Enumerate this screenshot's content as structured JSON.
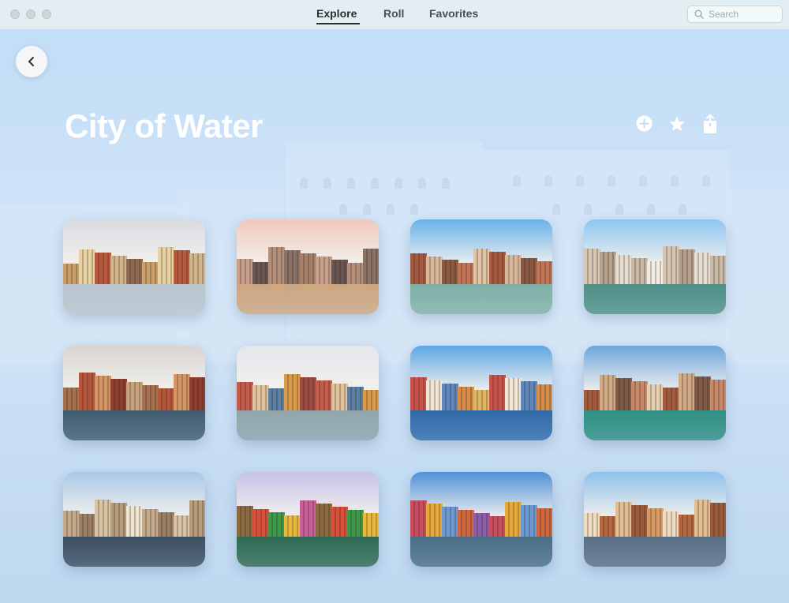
{
  "titlebar": {
    "tabs": [
      {
        "label": "Explore",
        "active": true
      },
      {
        "label": "Roll",
        "active": false
      },
      {
        "label": "Favorites",
        "active": false
      }
    ],
    "search": {
      "placeholder": "Search",
      "icon": "search-icon"
    }
  },
  "page": {
    "title": "City of Water",
    "back_icon": "chevron-left-icon",
    "actions": [
      {
        "name": "add",
        "icon": "plus-circle-icon"
      },
      {
        "name": "favorite",
        "icon": "star-icon"
      },
      {
        "name": "share",
        "icon": "share-icon"
      }
    ]
  },
  "photos": [
    {
      "subject": "stockholm-waterfront",
      "sky": "#d9dbe0",
      "water": "#b9c4cc",
      "city": [
        "#c9a06a",
        "#e8d2a4",
        "#b9593c",
        "#d3b58a",
        "#8d6a4f"
      ]
    },
    {
      "subject": "river-bridge-sunset",
      "sky": "#f1c8bd",
      "water": "#cda67e",
      "city": [
        "#a8806a",
        "#c9a08b",
        "#6a5650",
        "#b48f7a",
        "#8a7266"
      ]
    },
    {
      "subject": "grand-canal-day",
      "sky": "#69b2ea",
      "water": "#7fb0a6",
      "city": [
        "#c27556",
        "#e1c4a3",
        "#a55a3f",
        "#d9b89a",
        "#8a5a42"
      ]
    },
    {
      "subject": "canal-poles-palaces",
      "sky": "#8ec6f0",
      "water": "#4d8f86",
      "city": [
        "#e6ddd0",
        "#c9b9a5",
        "#f2ece3",
        "#d7c6b1",
        "#b5a08a"
      ]
    },
    {
      "subject": "narrow-canal-boats",
      "sky": "#d7d4d1",
      "water": "#3f5d6e",
      "city": [
        "#b5563a",
        "#d59663",
        "#8f3f2d",
        "#c7a37e",
        "#a6714e"
      ]
    },
    {
      "subject": "colorful-canal-cloudy",
      "sky": "#e4e6ea",
      "water": "#8fa5aa",
      "city": [
        "#c55b4b",
        "#e2c29a",
        "#5d7fa3",
        "#d99b4a",
        "#9d4b3e"
      ]
    },
    {
      "subject": "harbor-sailboats",
      "sky": "#5da8e6",
      "water": "#2f6aa8",
      "city": [
        "#e0b861",
        "#c8524a",
        "#f0e5d4",
        "#5e87bd",
        "#d68d4a"
      ]
    },
    {
      "subject": "green-canal-aerial",
      "sky": "#6ea6dc",
      "water": "#2f8f82",
      "city": [
        "#c98a6a",
        "#e4cfb1",
        "#a45c3e",
        "#d2aa86",
        "#7f5a46"
      ]
    },
    {
      "subject": "reflection-canal",
      "sky": "#a9c8e6",
      "water": "#3c4f61",
      "city": [
        "#d8c3a2",
        "#b79c7c",
        "#efe4d0",
        "#c4a98a",
        "#9b8066"
      ]
    },
    {
      "subject": "burano-bright-houses",
      "sky": "#c8c2e6",
      "water": "#2f6a52",
      "city": [
        "#d94f3a",
        "#3e9a4a",
        "#e8b93a",
        "#c95f9a",
        "#8a6a3e"
      ]
    },
    {
      "subject": "burano-curved-canal",
      "sky": "#4f90d8",
      "water": "#4a6e86",
      "city": [
        "#c94d5e",
        "#e7a83a",
        "#6a9ad1",
        "#d0673e",
        "#8d5fa8"
      ]
    },
    {
      "subject": "venetian-arches-gondolas",
      "sky": "#8fc1ea",
      "water": "#5a6f83",
      "city": [
        "#d79a62",
        "#f0dcc0",
        "#b5673e",
        "#e3be92",
        "#9b5a3a"
      ]
    }
  ]
}
